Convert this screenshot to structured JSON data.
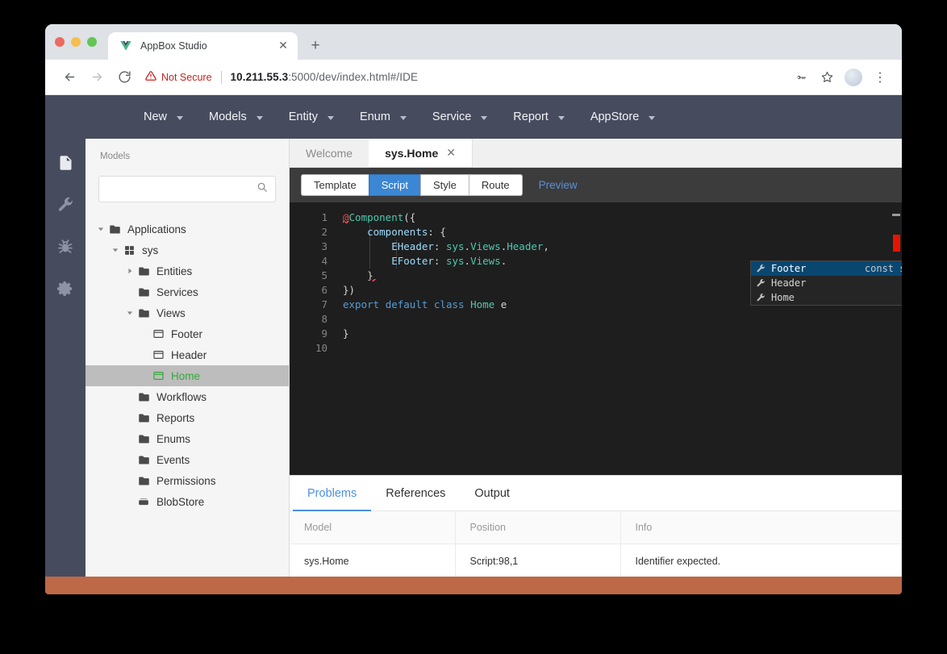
{
  "browser": {
    "tab": {
      "title": "AppBox Studio",
      "favicon": "vue-logo-icon",
      "close": "✕"
    },
    "new_tab": "+",
    "nav": {
      "back": "←",
      "forward": "→",
      "reload": "↻"
    },
    "security": {
      "icon": "warning-triangle-icon",
      "label": "Not Secure"
    },
    "url": {
      "host": "10.211.55.3",
      "path": ":5000/dev/index.html#/IDE",
      "full": "10.211.55.3:5000/dev/index.html#/IDE"
    },
    "actions": {
      "key": "key-icon",
      "bookmark": "star-icon",
      "profile": "avatar",
      "menu": "⋮"
    }
  },
  "menubar": {
    "items": [
      {
        "label": "New"
      },
      {
        "label": "Models"
      },
      {
        "label": "Entity"
      },
      {
        "label": "Enum"
      },
      {
        "label": "Service"
      },
      {
        "label": "Report"
      },
      {
        "label": "AppStore"
      }
    ]
  },
  "rail": {
    "items": [
      {
        "name": "file-icon",
        "active": true
      },
      {
        "name": "wrench-icon",
        "active": false
      },
      {
        "name": "bug-icon",
        "active": false
      },
      {
        "name": "gear-icon",
        "active": false
      }
    ]
  },
  "models_panel": {
    "title": "Models",
    "search": {
      "value": "",
      "placeholder": "",
      "icon": "search-icon"
    },
    "tree": [
      {
        "label": "Applications",
        "icon": "folder-icon",
        "depth": 0,
        "twisty": "down",
        "selected": false
      },
      {
        "label": "sys",
        "icon": "apps-grid-icon",
        "depth": 1,
        "twisty": "down",
        "selected": false
      },
      {
        "label": "Entities",
        "icon": "folder-icon",
        "depth": 2,
        "twisty": "right",
        "selected": false
      },
      {
        "label": "Services",
        "icon": "folder-icon",
        "depth": 2,
        "twisty": "none",
        "selected": false
      },
      {
        "label": "Views",
        "icon": "folder-icon",
        "depth": 2,
        "twisty": "down",
        "selected": false
      },
      {
        "label": "Footer",
        "icon": "view-icon",
        "depth": 3,
        "twisty": "none",
        "selected": false
      },
      {
        "label": "Header",
        "icon": "view-icon",
        "depth": 3,
        "twisty": "none",
        "selected": false
      },
      {
        "label": "Home",
        "icon": "view-icon",
        "depth": 3,
        "twisty": "none",
        "selected": true
      },
      {
        "label": "Workflows",
        "icon": "folder-icon",
        "depth": 2,
        "twisty": "none",
        "selected": false
      },
      {
        "label": "Reports",
        "icon": "folder-icon",
        "depth": 2,
        "twisty": "none",
        "selected": false
      },
      {
        "label": "Enums",
        "icon": "folder-icon",
        "depth": 2,
        "twisty": "none",
        "selected": false
      },
      {
        "label": "Events",
        "icon": "folder-icon",
        "depth": 2,
        "twisty": "none",
        "selected": false
      },
      {
        "label": "Permissions",
        "icon": "folder-icon",
        "depth": 2,
        "twisty": "none",
        "selected": false
      },
      {
        "label": "BlobStore",
        "icon": "blobstore-icon",
        "depth": 2,
        "twisty": "none",
        "selected": false
      }
    ]
  },
  "editor": {
    "tabs": [
      {
        "label": "Welcome",
        "active": false,
        "closable": false
      },
      {
        "label": "sys.Home",
        "active": true,
        "closable": true,
        "close": "✕"
      }
    ],
    "modes": [
      {
        "label": "Template",
        "active": false
      },
      {
        "label": "Script",
        "active": true
      },
      {
        "label": "Style",
        "active": false
      },
      {
        "label": "Route",
        "active": false
      }
    ],
    "preview_link": "Preview",
    "line_numbers": [
      "1",
      "2",
      "3",
      "4",
      "5",
      "6",
      "7",
      "8",
      "9",
      "10"
    ],
    "code": [
      {
        "n": 1,
        "text": "@Component({"
      },
      {
        "n": 2,
        "text": "    components: {"
      },
      {
        "n": 3,
        "text": "        EHeader: sys.Views.Header,"
      },
      {
        "n": 4,
        "text": "        EFooter: sys.Views."
      },
      {
        "n": 5,
        "text": "    }"
      },
      {
        "n": 6,
        "text": "})"
      },
      {
        "n": 7,
        "text": "export default class Home e"
      },
      {
        "n": 8,
        "text": ""
      },
      {
        "n": 9,
        "text": "}"
      },
      {
        "n": 10,
        "text": ""
      }
    ],
    "autocomplete": {
      "items": [
        {
          "label": "Footer",
          "icon": "wrench-icon",
          "selected": true,
          "detail": "const sys.Views.Footer: Promise<any>",
          "info": "ⓘ"
        },
        {
          "label": "Header",
          "icon": "wrench-icon",
          "selected": false,
          "detail": "",
          "info": ""
        },
        {
          "label": "Home",
          "icon": "wrench-icon",
          "selected": false,
          "detail": "",
          "info": ""
        }
      ]
    }
  },
  "bottom_panel": {
    "tabs": [
      {
        "label": "Problems",
        "active": true
      },
      {
        "label": "References",
        "active": false
      },
      {
        "label": "Output",
        "active": false
      }
    ],
    "table": {
      "headers": [
        "Model",
        "Position",
        "Info"
      ],
      "rows": [
        {
          "model": "sys.Home",
          "position": "Script:98,1",
          "info": "Identifier expected."
        }
      ]
    }
  },
  "colors": {
    "menubar": "#464b5e",
    "accent_blue": "#3b87d4",
    "status_bar": "#bd6846",
    "selected_tree_text": "#35a83a",
    "error_red": "#e51400"
  }
}
